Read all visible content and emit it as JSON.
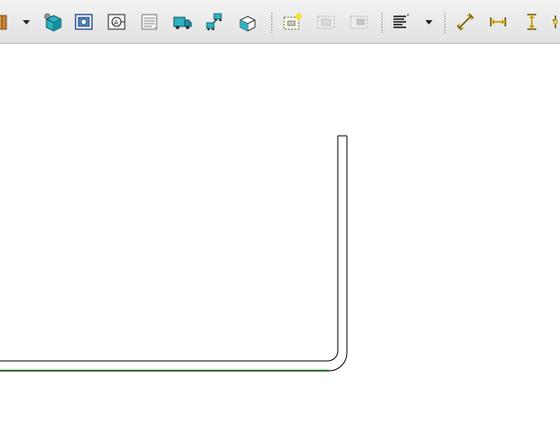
{
  "toolbar": {
    "groups": [
      {
        "name": "view-tools",
        "items": [
          {
            "icon": "door-part-icon",
            "state": "partial"
          },
          {
            "icon": "chevron-down-icon",
            "kind": "dropdown"
          },
          {
            "icon": "3d-box-cyan-icon"
          },
          {
            "icon": "frame-view-icon"
          },
          {
            "icon": "annotation-view-icon"
          },
          {
            "icon": "table-list-icon"
          },
          {
            "icon": "truck-icon"
          },
          {
            "icon": "truck-pair-icon"
          },
          {
            "icon": "box-outline-icon"
          }
        ]
      },
      {
        "name": "edit-tools",
        "items": [
          {
            "icon": "select-region-icon"
          },
          {
            "icon": "copy-region-icon",
            "state": "disabled"
          },
          {
            "icon": "move-region-icon",
            "state": "disabled"
          }
        ]
      },
      {
        "name": "text-tools",
        "items": [
          {
            "icon": "text-align-icon"
          },
          {
            "icon": "chevron-down-icon",
            "kind": "dropdown"
          }
        ]
      },
      {
        "name": "dimension-tools",
        "items": [
          {
            "icon": "aligned-dimension-icon"
          },
          {
            "icon": "horizontal-dimension-icon"
          },
          {
            "icon": "vertical-dimension-icon"
          },
          {
            "icon": "chain-dimension-icon",
            "state": "partial"
          }
        ]
      }
    ]
  },
  "drawing": {
    "shape": "bent-panel-outline",
    "colors": {
      "outline": "#000000",
      "baseline": "#33cc33",
      "toolbar_bg": "#e6e6e6",
      "icon_teal": "#2ab3c3",
      "icon_gold": "#c9a400"
    }
  }
}
